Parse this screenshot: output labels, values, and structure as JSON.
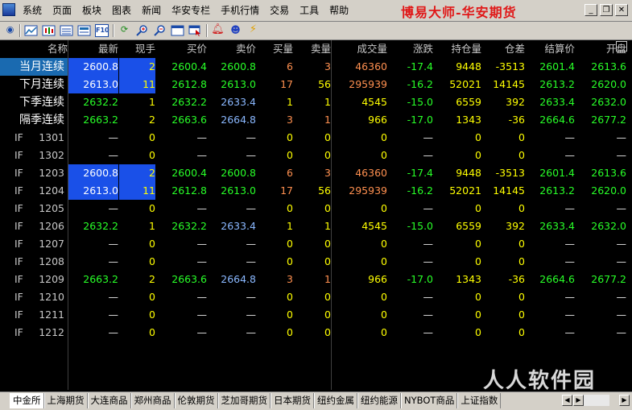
{
  "menu": [
    "系统",
    "页面",
    "板块",
    "图表",
    "新闻",
    "华安专栏",
    "手机行情",
    "交易",
    "工具",
    "帮助"
  ],
  "brand": "博易大师-华安期货",
  "columns": [
    "名称",
    "最新",
    "现手",
    "买价",
    "卖价",
    "买量",
    "卖量",
    "成交量",
    "涨跌",
    "持仓量",
    "仓差",
    "结算价",
    "开盘"
  ],
  "rows": [
    {
      "code": "",
      "name": "当月连续",
      "last": "2600.8",
      "vol": "2",
      "bid": "2600.4",
      "ask": "2600.8",
      "bidv": "6",
      "askv": "3",
      "total": "46360",
      "chg": "-17.4",
      "oi": "9448",
      "oid": "-3513",
      "settle": "2601.4",
      "open": "2613.6"
    },
    {
      "code": "",
      "name": "下月连续",
      "last": "2613.0",
      "vol": "11",
      "bid": "2612.8",
      "ask": "2613.0",
      "bidv": "17",
      "askv": "56",
      "total": "295939",
      "chg": "-16.2",
      "oi": "52021",
      "oid": "14145",
      "settle": "2613.2",
      "open": "2620.0"
    },
    {
      "code": "",
      "name": "下季连续",
      "last": "2632.2",
      "vol": "1",
      "bid": "2632.2",
      "ask": "2633.4",
      "bidv": "1",
      "askv": "1",
      "total": "4545",
      "chg": "-15.0",
      "oi": "6559",
      "oid": "392",
      "settle": "2633.4",
      "open": "2632.0"
    },
    {
      "code": "",
      "name": "隔季连续",
      "last": "2663.2",
      "vol": "2",
      "bid": "2663.6",
      "ask": "2664.8",
      "bidv": "3",
      "askv": "1",
      "total": "966",
      "chg": "-17.0",
      "oi": "1343",
      "oid": "-36",
      "settle": "2664.6",
      "open": "2677.2"
    },
    {
      "code": "IF",
      "name": "1301",
      "last": "—",
      "vol": "0",
      "bid": "—",
      "ask": "—",
      "bidv": "0",
      "askv": "0",
      "total": "0",
      "chg": "—",
      "oi": "0",
      "oid": "0",
      "settle": "—",
      "open": "—"
    },
    {
      "code": "IF",
      "name": "1302",
      "last": "—",
      "vol": "0",
      "bid": "—",
      "ask": "—",
      "bidv": "0",
      "askv": "0",
      "total": "0",
      "chg": "—",
      "oi": "0",
      "oid": "0",
      "settle": "—",
      "open": "—"
    },
    {
      "code": "IF",
      "name": "1203",
      "last": "2600.8",
      "vol": "2",
      "bid": "2600.4",
      "ask": "2600.8",
      "bidv": "6",
      "askv": "3",
      "total": "46360",
      "chg": "-17.4",
      "oi": "9448",
      "oid": "-3513",
      "settle": "2601.4",
      "open": "2613.6"
    },
    {
      "code": "IF",
      "name": "1204",
      "last": "2613.0",
      "vol": "11",
      "bid": "2612.8",
      "ask": "2613.0",
      "bidv": "17",
      "askv": "56",
      "total": "295939",
      "chg": "-16.2",
      "oi": "52021",
      "oid": "14145",
      "settle": "2613.2",
      "open": "2620.0"
    },
    {
      "code": "IF",
      "name": "1205",
      "last": "—",
      "vol": "0",
      "bid": "—",
      "ask": "—",
      "bidv": "0",
      "askv": "0",
      "total": "0",
      "chg": "—",
      "oi": "0",
      "oid": "0",
      "settle": "—",
      "open": "—"
    },
    {
      "code": "IF",
      "name": "1206",
      "last": "2632.2",
      "vol": "1",
      "bid": "2632.2",
      "ask": "2633.4",
      "bidv": "1",
      "askv": "1",
      "total": "4545",
      "chg": "-15.0",
      "oi": "6559",
      "oid": "392",
      "settle": "2633.4",
      "open": "2632.0"
    },
    {
      "code": "IF",
      "name": "1207",
      "last": "—",
      "vol": "0",
      "bid": "—",
      "ask": "—",
      "bidv": "0",
      "askv": "0",
      "total": "0",
      "chg": "—",
      "oi": "0",
      "oid": "0",
      "settle": "—",
      "open": "—"
    },
    {
      "code": "IF",
      "name": "1208",
      "last": "—",
      "vol": "0",
      "bid": "—",
      "ask": "—",
      "bidv": "0",
      "askv": "0",
      "total": "0",
      "chg": "—",
      "oi": "0",
      "oid": "0",
      "settle": "—",
      "open": "—"
    },
    {
      "code": "IF",
      "name": "1209",
      "last": "2663.2",
      "vol": "2",
      "bid": "2663.6",
      "ask": "2664.8",
      "bidv": "3",
      "askv": "1",
      "total": "966",
      "chg": "-17.0",
      "oi": "1343",
      "oid": "-36",
      "settle": "2664.6",
      "open": "2677.2"
    },
    {
      "code": "IF",
      "name": "1210",
      "last": "—",
      "vol": "0",
      "bid": "—",
      "ask": "—",
      "bidv": "0",
      "askv": "0",
      "total": "0",
      "chg": "—",
      "oi": "0",
      "oid": "0",
      "settle": "—",
      "open": "—"
    },
    {
      "code": "IF",
      "name": "1211",
      "last": "—",
      "vol": "0",
      "bid": "—",
      "ask": "—",
      "bidv": "0",
      "askv": "0",
      "total": "0",
      "chg": "—",
      "oi": "0",
      "oid": "0",
      "settle": "—",
      "open": "—"
    },
    {
      "code": "IF",
      "name": "1212",
      "last": "—",
      "vol": "0",
      "bid": "—",
      "ask": "—",
      "bidv": "0",
      "askv": "0",
      "total": "0",
      "chg": "—",
      "oi": "0",
      "oid": "0",
      "settle": "—",
      "open": "—"
    }
  ],
  "tabs": [
    "中金所",
    "上海期货",
    "大连商品",
    "郑州商品",
    "伦敦期货",
    "芝加哥期货",
    "日本期货",
    "纽约金属",
    "纽约能源",
    "NYBOT商品",
    "上证指数"
  ],
  "watermark": "人人软件园",
  "colors": {
    "up": "#ff3030",
    "down": "#28ff28",
    "highlight": "#1a50e8",
    "brand": "#e01818"
  }
}
